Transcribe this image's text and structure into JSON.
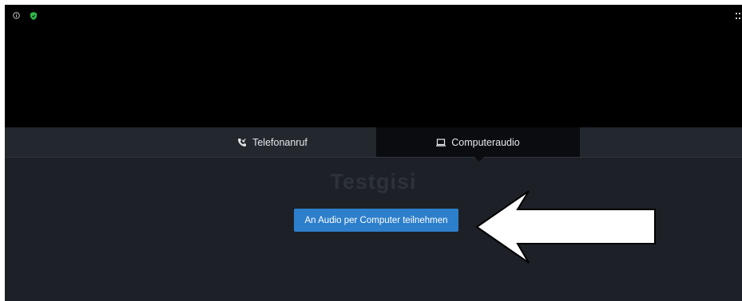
{
  "tabs": {
    "phone_label": "Telefonanruf",
    "computer_label": "Computeraudio"
  },
  "meeting": {
    "title": "Testgisi"
  },
  "join_button": {
    "label": "An Audio per Computer teilnehmen"
  },
  "colors": {
    "accent": "#2d7fcb",
    "shield": "#2fb84a",
    "background": "#1d2127",
    "active_tab": "#0a0c0f"
  },
  "icons": {
    "info": "info-icon",
    "shield": "shield-check-icon",
    "grid": "grid-icon",
    "phone": "phone-icon",
    "laptop": "laptop-icon",
    "arrow": "arrow-icon"
  }
}
